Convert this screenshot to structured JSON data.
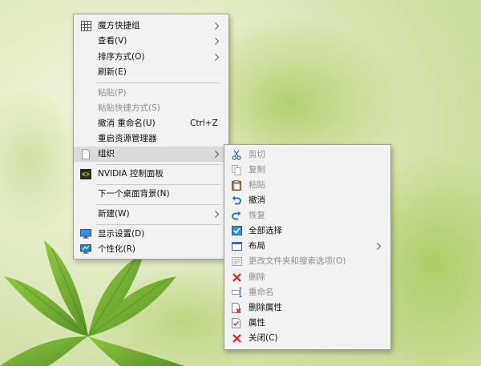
{
  "context_menu": {
    "items": [
      {
        "label": "魔方快捷组",
        "icon": "grid-icon",
        "has_submenu": true
      },
      {
        "label": "查看(V)",
        "has_submenu": true
      },
      {
        "label": "排序方式(O)",
        "has_submenu": true
      },
      {
        "label": "刷新(E)"
      },
      {
        "label": "粘贴(P)",
        "disabled": true
      },
      {
        "label": "粘贴快捷方式(S)",
        "disabled": true
      },
      {
        "label": "撤消 重命名(U)",
        "shortcut": "Ctrl+Z"
      },
      {
        "label": "重启资源管理器"
      },
      {
        "label": "组织",
        "has_submenu": true,
        "highlighted": true
      },
      {
        "label": "NVIDIA 控制面板",
        "icon": "nvidia-icon"
      },
      {
        "label": "下一个桌面背景(N)"
      },
      {
        "label": "新建(W)",
        "has_submenu": true
      },
      {
        "label": "显示设置(D)",
        "icon": "display-icon"
      },
      {
        "label": "个性化(R)",
        "icon": "personalize-icon"
      }
    ]
  },
  "organize_submenu": {
    "items": [
      {
        "label": "剪切",
        "icon": "scissors-icon",
        "disabled": true
      },
      {
        "label": "复制",
        "icon": "copy-icon",
        "disabled": true
      },
      {
        "label": "粘贴",
        "icon": "paste-icon",
        "disabled": true
      },
      {
        "label": "撤消",
        "icon": "undo-icon"
      },
      {
        "label": "恢复",
        "icon": "redo-icon",
        "disabled": true
      },
      {
        "label": "全部选择",
        "icon": "select-all-icon"
      },
      {
        "label": "布局",
        "icon": "layout-icon",
        "has_submenu": true
      },
      {
        "label": "更改文件夹和搜索选项(O)",
        "icon": "folder-options-icon",
        "disabled": true
      },
      {
        "label": "删除",
        "icon": "delete-x-icon",
        "disabled": true
      },
      {
        "label": "重命名",
        "icon": "rename-icon",
        "disabled": true
      },
      {
        "label": "删除属性",
        "icon": "remove-properties-icon"
      },
      {
        "label": "属性",
        "icon": "properties-icon"
      },
      {
        "label": "关闭(C)",
        "icon": "close-x-icon"
      }
    ]
  },
  "colors": {
    "menu_bg": "#f2f2f2",
    "highlight_bg": "#dadada",
    "disabled_text": "#8d8d8d",
    "delete_red": "#d1262b",
    "undo_blue": "#2a77c9"
  }
}
